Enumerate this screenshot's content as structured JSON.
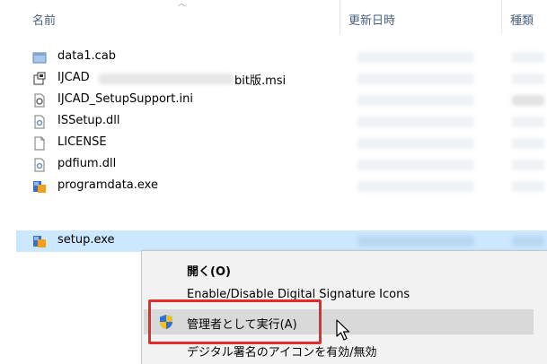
{
  "header": {
    "col_name": "名前",
    "col_date": "更新日時",
    "col_type": "種類"
  },
  "files": [
    {
      "name": "data1.cab",
      "icon": "cab-archive-icon"
    },
    {
      "name_prefix": "IJCAD",
      "name_suffix": "bit版.msi",
      "icon": "msi-installer-icon"
    },
    {
      "name": "IJCAD_SetupSupport.ini",
      "icon": "ini-settings-icon"
    },
    {
      "name": "ISSetup.dll",
      "icon": "dll-file-icon"
    },
    {
      "name": "LICENSE",
      "icon": "blank-file-icon"
    },
    {
      "name": "pdfium.dll",
      "icon": "dll-file-icon"
    },
    {
      "name": "programdata.exe",
      "icon": "exe-app-icon"
    },
    {
      "name": "setup.exe",
      "icon": "setup-exe-icon",
      "selected": true
    }
  ],
  "context_menu": {
    "items": [
      {
        "label": "開く(O)"
      },
      {
        "label": "Enable/Disable Digital Signature Icons"
      },
      {
        "label": "管理者として実行(A)",
        "icon": "uac-shield-icon",
        "highlighted": true
      },
      {
        "label": "デジタル署名のアイコンを有効/無効"
      }
    ]
  },
  "colors": {
    "selection": "#cce8ff",
    "menu_bg": "#f2f2f2",
    "menu_highlight": "#d9d9d9",
    "annotation_red": "#e52b2b",
    "header_text": "#4c607a"
  }
}
